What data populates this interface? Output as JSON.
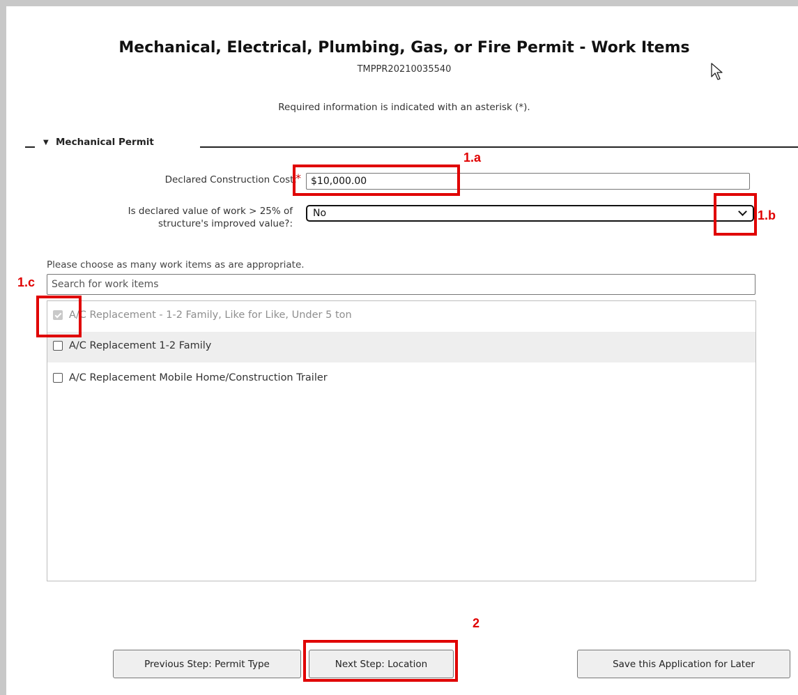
{
  "page": {
    "title": "Mechanical, Electrical, Plumbing, Gas, or Fire Permit - Work Items",
    "record_id": "TMPPR20210035540",
    "required_note": "Required information is indicated with an asterisk (*)."
  },
  "section": {
    "label": "Mechanical Permit",
    "collapse_icon": "caret-down-icon"
  },
  "form": {
    "declared_cost_label": "Declared Construction Cost:",
    "required_marker": "*",
    "declared_cost_value": "$10,000.00",
    "question_label_line1": "Is declared value of work > 25% of",
    "question_label_line2": "structure's improved value?:",
    "question_selected": "No"
  },
  "work_items": {
    "instructions": "Please choose as many work items as are appropriate.",
    "search_placeholder": "Search for work items",
    "items": [
      {
        "label": "A/C Replacement - 1-2 Family, Like for Like, Under 5 ton",
        "checked": true,
        "disabled": true
      },
      {
        "label": "A/C Replacement 1-2 Family",
        "checked": false,
        "disabled": false
      },
      {
        "label": "A/C Replacement Mobile Home/Construction Trailer",
        "checked": false,
        "disabled": false
      }
    ]
  },
  "buttons": {
    "previous": "Previous Step: Permit Type",
    "next": "Next Step: Location",
    "save": "Save this Application for Later"
  },
  "annotations": {
    "a1a": "1.a",
    "a1b": "1.b",
    "a1c": "1.c",
    "a2": "2",
    "color": "#e00000"
  }
}
